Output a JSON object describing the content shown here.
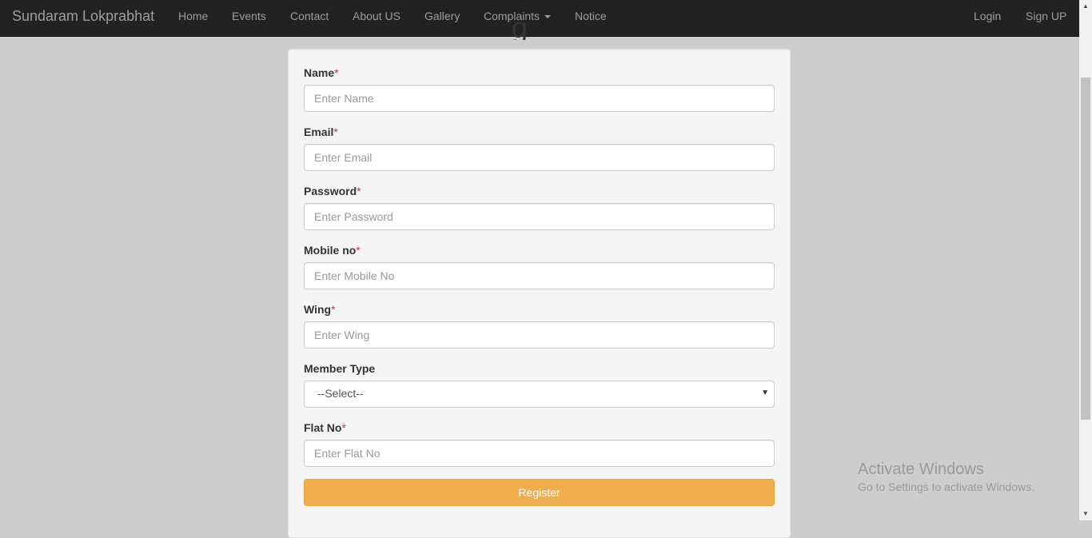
{
  "navbar": {
    "brand": "Sundaram Lokprabhat",
    "items": [
      {
        "label": "Home"
      },
      {
        "label": "Events"
      },
      {
        "label": "Contact"
      },
      {
        "label": "About US"
      },
      {
        "label": "Gallery"
      },
      {
        "label": "Complaints"
      },
      {
        "label": "Notice"
      }
    ],
    "right_items": [
      {
        "label": "Login"
      },
      {
        "label": "Sign UP"
      }
    ]
  },
  "heading_partial": "g",
  "form": {
    "required_marker": "*",
    "fields": [
      {
        "label": "Name",
        "placeholder": "Enter Name"
      },
      {
        "label": "Email",
        "placeholder": "Enter Email"
      },
      {
        "label": "Password",
        "placeholder": "Enter Password"
      },
      {
        "label": "Mobile no",
        "placeholder": "Enter Mobile No"
      },
      {
        "label": "Wing",
        "placeholder": "Enter Wing"
      }
    ],
    "member_type": {
      "label": "Member Type",
      "selected": "--Select--"
    },
    "flat_no": {
      "label": "Flat No",
      "placeholder": "Enter Flat No"
    },
    "submit_label": "Register"
  },
  "watermark": {
    "title": "Activate Windows",
    "subtitle": "Go to Settings to activate Windows."
  },
  "colors": {
    "navbar_bg": "#222222",
    "button_bg": "#f0ad4e",
    "required": "#a94442"
  }
}
